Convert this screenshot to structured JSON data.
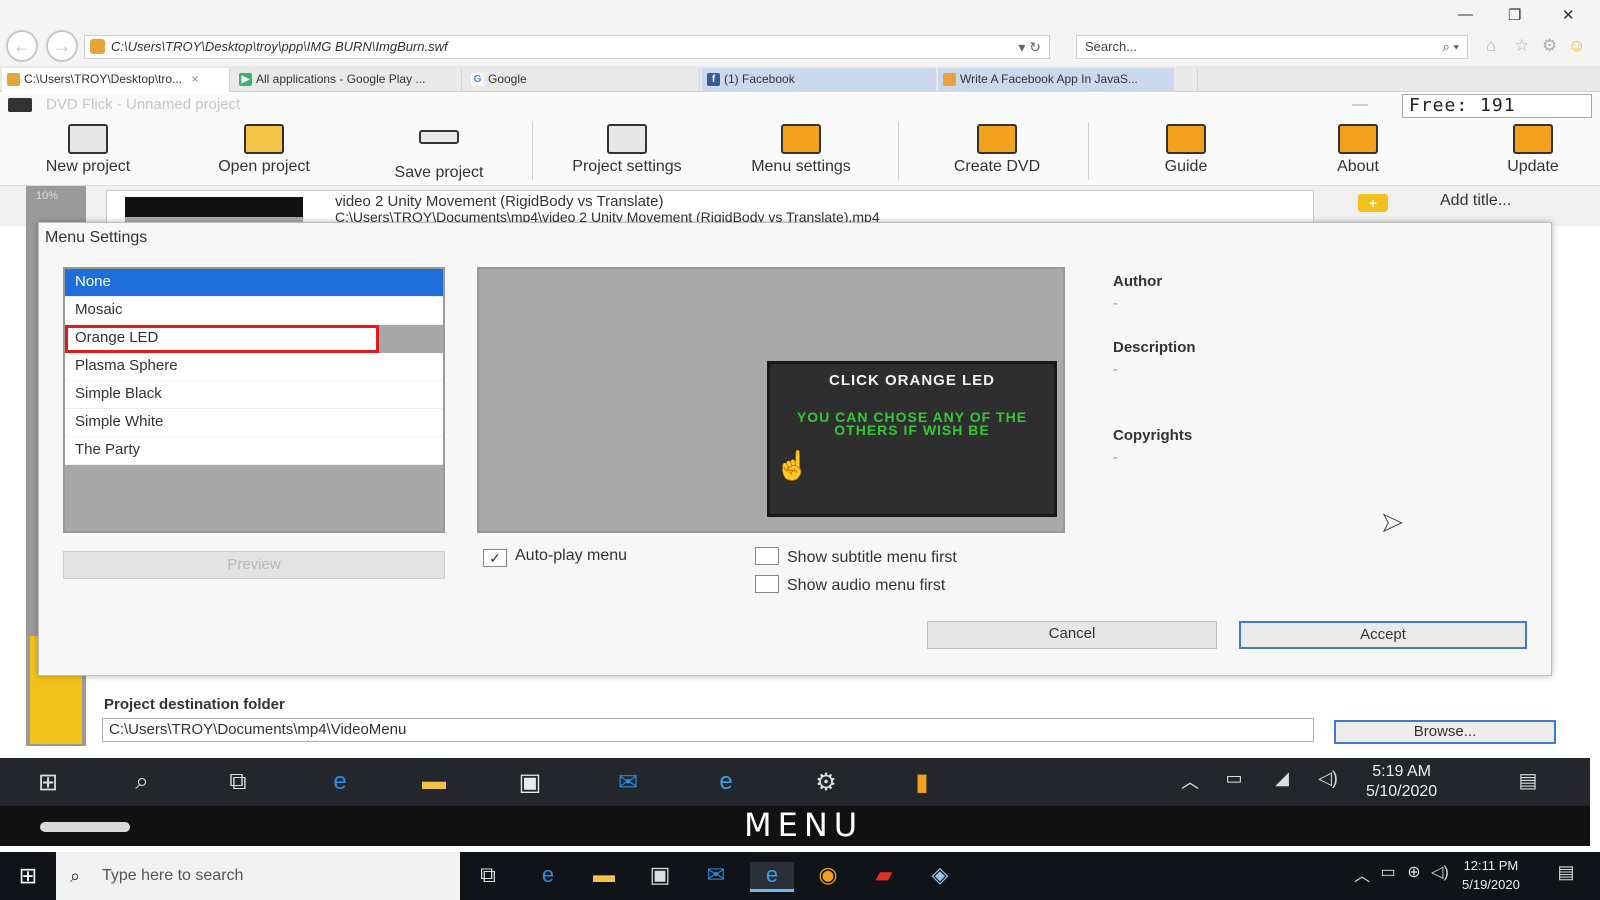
{
  "browser": {
    "address": "C:\\Users\\TROY\\Desktop\\troy\\ppp\\IMG BURN\\ImgBurn.swf",
    "search_placeholder": "Search...",
    "tabs": [
      {
        "label": "C:\\Users\\TROY\\Desktop\\tro...",
        "close": "×"
      },
      {
        "label": "All applications - Google Play ..."
      },
      {
        "label": "Google"
      },
      {
        "label": "(1) Facebook"
      },
      {
        "label": "Write A Facebook App In JavaS..."
      }
    ]
  },
  "app": {
    "title": "DVD Flick - Unnamed project",
    "free_space": "Free: 191",
    "toolbar": [
      {
        "label": "New project",
        "icon": "film-icon"
      },
      {
        "label": "Open project",
        "icon": "folder-icon"
      },
      {
        "label": "Save project",
        "icon": "save-icon"
      },
      {
        "label": "Project settings",
        "icon": "settings-icon"
      },
      {
        "label": "Menu settings",
        "icon": "menu-icon"
      },
      {
        "label": "Create DVD",
        "icon": "dvd-icon"
      },
      {
        "label": "Guide",
        "icon": "guide-icon"
      },
      {
        "label": "About",
        "icon": "about-icon"
      },
      {
        "label": "Update",
        "icon": "update-icon"
      }
    ],
    "progress_label": "10%",
    "title_item": {
      "name": "video 2 Unity Movement (RigidBody vs Translate)",
      "path": "C:\\Users\\TROY\\Documents\\mp4\\video 2 Unity Movement (RigidBody vs Translate).mp4"
    },
    "add_title": "Add title...",
    "destination_label": "Project destination folder",
    "destination_value": "C:\\Users\\TROY\\Documents\\mp4\\VideoMenu",
    "browse": "Browse..."
  },
  "dialog": {
    "title": "Menu Settings",
    "menus": [
      "None",
      "Mosaic",
      "Orange LED",
      "Plasma Sphere",
      "Simple Black",
      "Simple White",
      "The Party"
    ],
    "selected": "None",
    "highlighted": "Orange LED",
    "preview_button": "Preview",
    "preview_title": "CLICK ORANGE LED",
    "preview_note": "YOU CAN CHOSE ANY OF THE OTHERS IF WISH BE",
    "checkboxes": {
      "autoplay": {
        "label": "Auto-play menu",
        "checked": true
      },
      "subtitle_first": {
        "label": "Show subtitle menu first",
        "checked": false
      },
      "audio_first": {
        "label": "Show audio menu first",
        "checked": false
      }
    },
    "author_label": "Author",
    "author_value": "-",
    "description_label": "Description",
    "description_value": "-",
    "copyrights_label": "Copyrights",
    "copyrights_value": "-",
    "cancel": "Cancel",
    "accept": "Accept"
  },
  "recorded_taskbar": {
    "time": "5:19 AM",
    "date": "5/10/2020",
    "caption": "MENU"
  },
  "host_taskbar": {
    "search_placeholder": "Type here to search",
    "time": "12:11 PM",
    "date": "5/19/2020"
  },
  "colors": {
    "selection_blue": "#1e6fd9",
    "highlight_red": "#e01b1b",
    "led_green": "#34c934",
    "accent_yellow": "#f2c21c"
  }
}
